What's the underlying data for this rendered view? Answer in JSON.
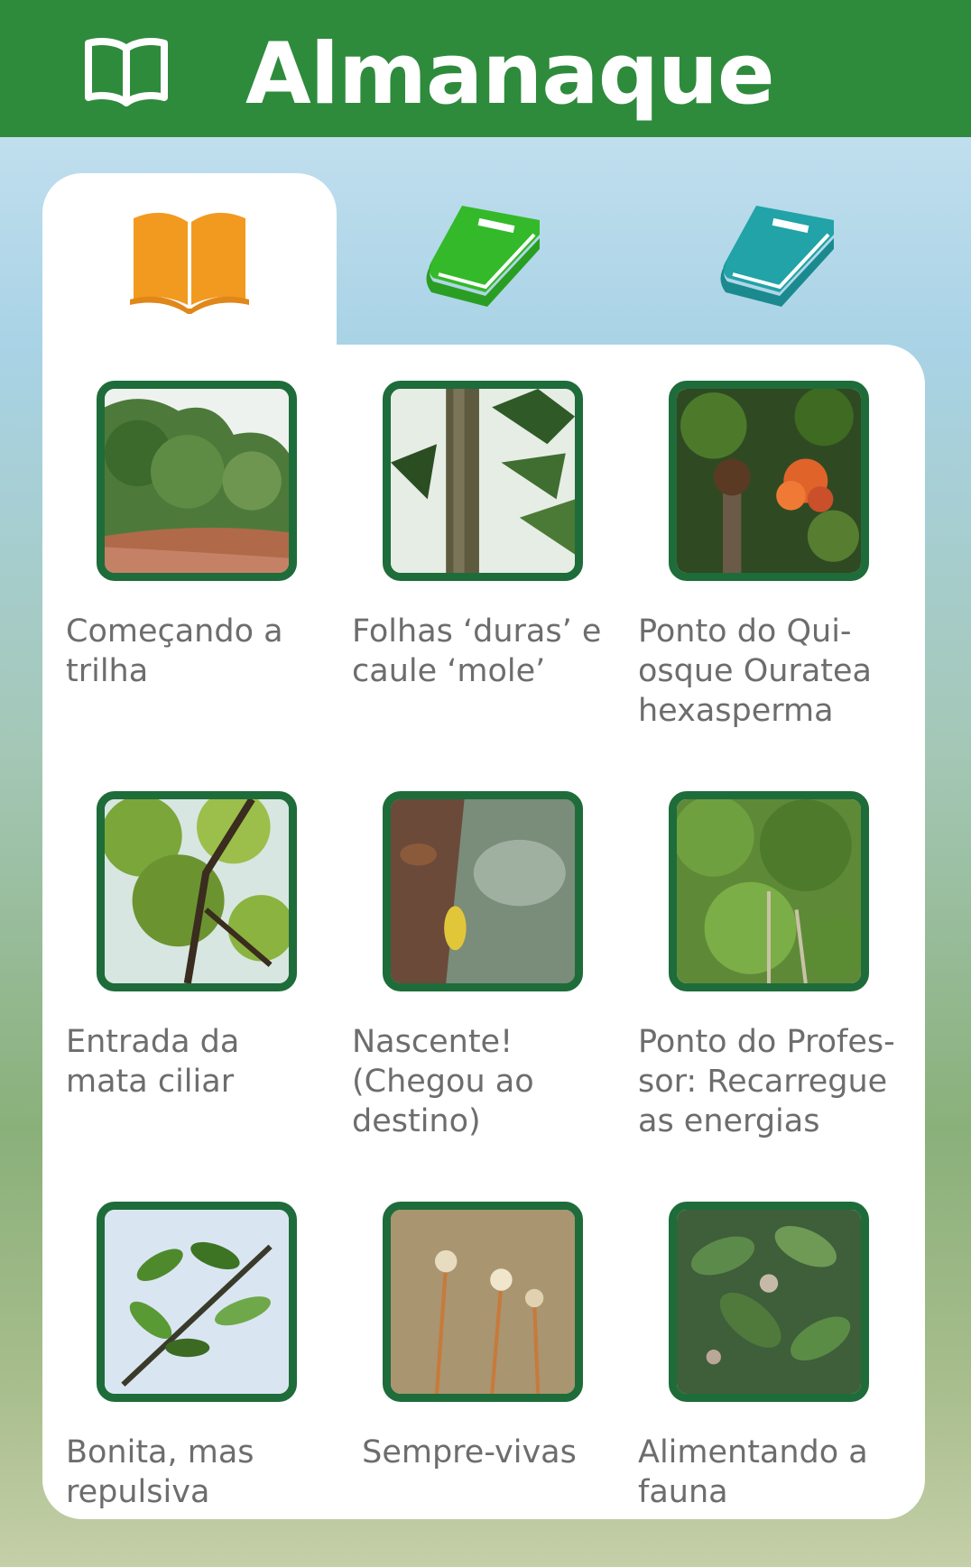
{
  "header": {
    "title": "Almanaque",
    "icon": "open-book-outline-icon"
  },
  "tabs": [
    {
      "icon": "open-book-orange-icon",
      "color": "#f29a1f",
      "active": true
    },
    {
      "icon": "closed-book-green-icon",
      "color": "#34b92a",
      "active": false
    },
    {
      "icon": "closed-book-teal-icon",
      "color": "#21a3a8",
      "active": false
    }
  ],
  "items": [
    {
      "caption": "Começando a trilha",
      "thumb": "trail-photo"
    },
    {
      "caption": "Folhas ‘duras’ e caule ‘mole’",
      "thumb": "trunk-leaves-photo"
    },
    {
      "caption": "Ponto do Qui-osque Ouratea hexasperma",
      "thumb": "orange-flowers-photo"
    },
    {
      "caption": "Entrada da mata ciliar",
      "thumb": "tree-canopy-photo"
    },
    {
      "caption": "Nascente! (Chegou ao destino)",
      "thumb": "spring-water-photo"
    },
    {
      "caption": "Ponto do Profes-sor: Recarregue as energias",
      "thumb": "green-bushes-photo"
    },
    {
      "caption": "Bonita, mas repulsiva",
      "thumb": "branch-sky-photo"
    },
    {
      "caption": "Sempre-vivas",
      "thumb": "dry-plants-photo"
    },
    {
      "caption": "Alimentando a fauna",
      "thumb": "shrub-leaves-photo"
    }
  ],
  "colors": {
    "appbar": "#2e8b3c",
    "thumb_border": "#1e6c3a",
    "caption_text": "#6d6d6d"
  }
}
